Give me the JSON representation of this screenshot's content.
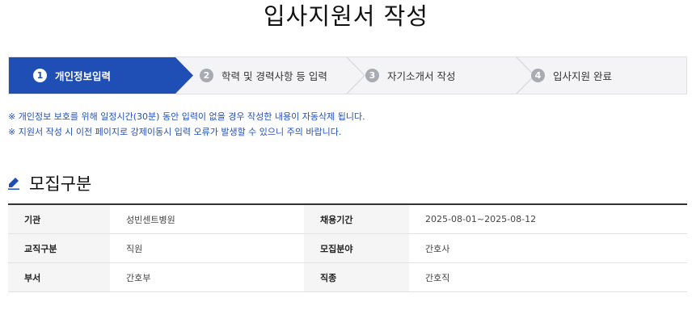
{
  "page": {
    "title": "입사지원서 작성"
  },
  "steps": [
    {
      "num": "1",
      "label": "개인정보입력",
      "active": true
    },
    {
      "num": "2",
      "label": "학력 및 경력사항 등 입력",
      "active": false
    },
    {
      "num": "3",
      "label": "자기소개서 작성",
      "active": false
    },
    {
      "num": "4",
      "label": "입사지원 완료",
      "active": false
    }
  ],
  "notices": [
    "※ 개인정보 보호를 위해 일정시간(30분) 동안 입력이 없을 경우 작성한 내용이 자동삭제 됩니다.",
    "※ 지원서 작성 시 이전 페이지로 강제이동시 입력 오류가 발생할 수 있으니 주의 바랍니다."
  ],
  "section": {
    "title": "모집구분",
    "icon": "pencil-icon"
  },
  "recruit_table": [
    {
      "label1": "기관",
      "value1": "성빈센트병원",
      "label2": "채용기간",
      "value2": "2025-08-01~2025-08-12"
    },
    {
      "label1": "교직구분",
      "value1": "직원",
      "label2": "모집분야",
      "value2": "간호사"
    },
    {
      "label1": "부서",
      "value1": "간호부",
      "label2": "직종",
      "value2": "간호직"
    }
  ],
  "colors": {
    "active_step": "#1f4fb4",
    "notice_text": "#2350b8",
    "step_bar_bg": "#f4f4f6"
  }
}
